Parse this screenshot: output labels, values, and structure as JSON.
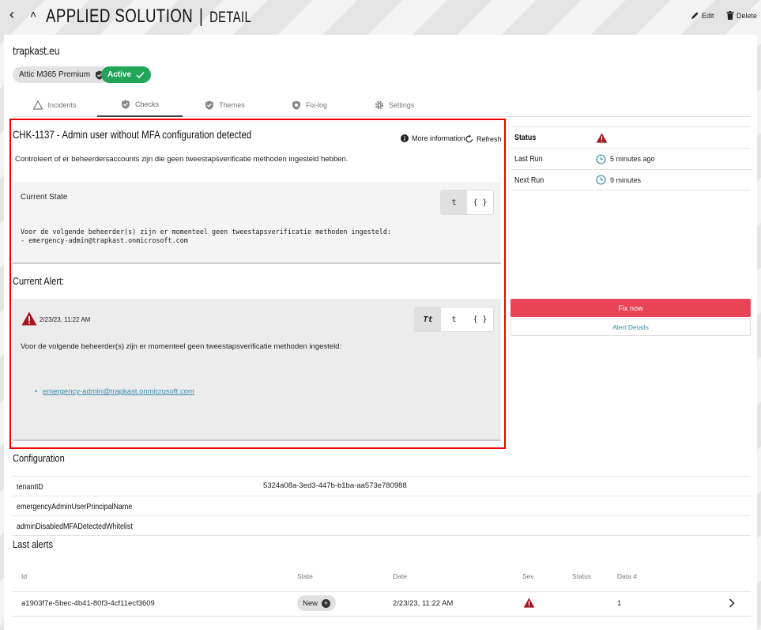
{
  "header": {
    "title": "APPLIED SOLUTION",
    "subtitle": "DETAIL",
    "edit_label": "Edit",
    "delete_label": "Delete"
  },
  "tenant": {
    "domain": "trapkast.eu",
    "license_badge": "Attic M365 Premium",
    "status_badge": "Active"
  },
  "tabs": [
    {
      "label": "Incidents",
      "icon": "triangle-icon"
    },
    {
      "label": "Checks",
      "icon": "shield-check-icon",
      "active": true
    },
    {
      "label": "Themes",
      "icon": "shield-check-icon"
    },
    {
      "label": "Fix-log",
      "icon": "shield-gear-icon"
    },
    {
      "label": "Settings",
      "icon": "gear-icon"
    }
  ],
  "check": {
    "title": "CHK-1137 - Admin user without MFA configuration detected",
    "more_info_label": "More information",
    "refresh_label": "Refresh",
    "description": "Controleert of er beheerdersaccounts zijn die geen tweestapsverificatie methoden ingesteld hebben.",
    "current_state_label": "Current State",
    "current_state_text": "Voor de volgende beheerder(s) zijn er momenteel geen tweestapsverificatie methoden ingesteld:\n- emergency-admin@trapkast.onmicrosoft.com",
    "state_toggle": [
      "t",
      "{ }"
    ]
  },
  "current_alert": {
    "title": "Current Alert:",
    "date": "2/23/23, 11:22 AM",
    "toggle": [
      "Tt",
      "t",
      "{ }"
    ],
    "message": "Voor de volgende beheerder(s) zijn er momenteel geen tweestapsverificatie methoden ingesteld:",
    "link": "emergency-admin@trapkast.onmicrosoft.com"
  },
  "status_panel": {
    "status_label": "Status",
    "last_run_label": "Last Run",
    "last_run_value": "5 minutes ago",
    "next_run_label": "Next Run",
    "next_run_value": "9 minutes",
    "fix_now_label": "Fix now",
    "alert_details_label": "Alert Details",
    "danger_color": "#a31622",
    "accent_color": "#e84357"
  },
  "configuration": {
    "title": "Configuration",
    "rows": [
      {
        "key": "tenantID",
        "value": "5324a08a-3ed3-447b-b1ba-aa573e780988"
      },
      {
        "key": "emergencyAdminUserPrincipalName",
        "value": ""
      },
      {
        "key": "adminDisabledMFADetectedWhitelist",
        "value": ""
      }
    ]
  },
  "last_alerts": {
    "title": "Last alerts",
    "columns": [
      "Id",
      "State",
      "Date",
      "Sev",
      "Status",
      "Data #"
    ],
    "rows": [
      {
        "id": "a1903f7e-5bec-4b41-80f3-4cf11ecf3609",
        "state": "New",
        "date": "2/23/23, 11:22 AM",
        "sev": "warning-icon",
        "status": "",
        "data": "1"
      }
    ]
  }
}
